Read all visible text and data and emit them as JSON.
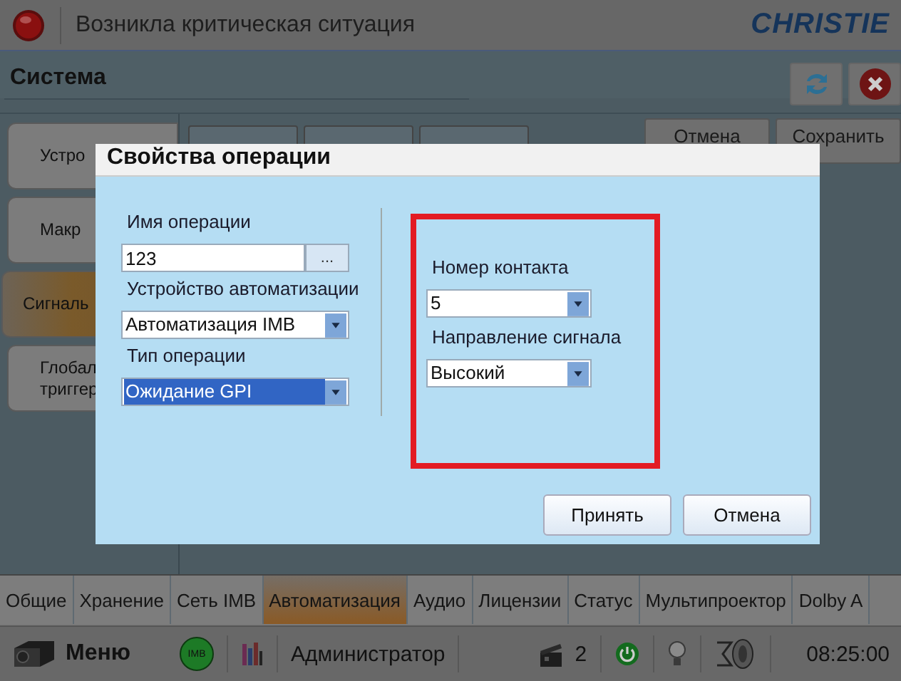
{
  "header": {
    "title": "Возникла критическая ситуация",
    "logo": "CHRISTIE"
  },
  "section": {
    "title": "Система"
  },
  "sidebar": {
    "items": [
      {
        "label": "Устро",
        "selected": false
      },
      {
        "label": "Макр",
        "selected": false
      },
      {
        "label": "Сигналь",
        "selected": true
      },
      {
        "label": "Глобал\nтриггер",
        "selected": false
      }
    ]
  },
  "top_buttons": [
    {
      "label": "Отмена"
    },
    {
      "label": "Сохранить"
    }
  ],
  "dialog": {
    "title": "Свойства операции",
    "fields": [
      {
        "kind": "text",
        "label": "Имя операции",
        "value": "123",
        "button": "..."
      },
      {
        "kind": "combo",
        "label": "Устройство автоматизации",
        "value": "Автоматизация IMB",
        "focused": false
      },
      {
        "kind": "combo",
        "label": "Тип операции",
        "value": "Ожидание GPI",
        "focused": true
      }
    ],
    "highlighted_fields": [
      {
        "kind": "combo",
        "label": "Номер контакта",
        "value": "5",
        "focused": false
      },
      {
        "kind": "combo",
        "label": "Направление сигнала",
        "value": "Высокий",
        "focused": false
      }
    ],
    "buttons": [
      "Принять",
      "Отмена"
    ]
  },
  "bottom_tabs": [
    {
      "label": "Общие",
      "selected": false
    },
    {
      "label": "Хранение",
      "selected": false
    },
    {
      "label": "Сеть IMB",
      "selected": false
    },
    {
      "label": "Автоматизация",
      "selected": true
    },
    {
      "label": "Аудио",
      "selected": false
    },
    {
      "label": "Лицензии",
      "selected": false
    },
    {
      "label": "Статус",
      "selected": false
    },
    {
      "label": "Мультипроектор",
      "selected": false
    },
    {
      "label": "Dolby A",
      "selected": false
    }
  ],
  "status_bar": {
    "menu": "Меню",
    "imb": "IMB",
    "user": "Администратор",
    "jobs": "2",
    "time": "08:25:00"
  }
}
